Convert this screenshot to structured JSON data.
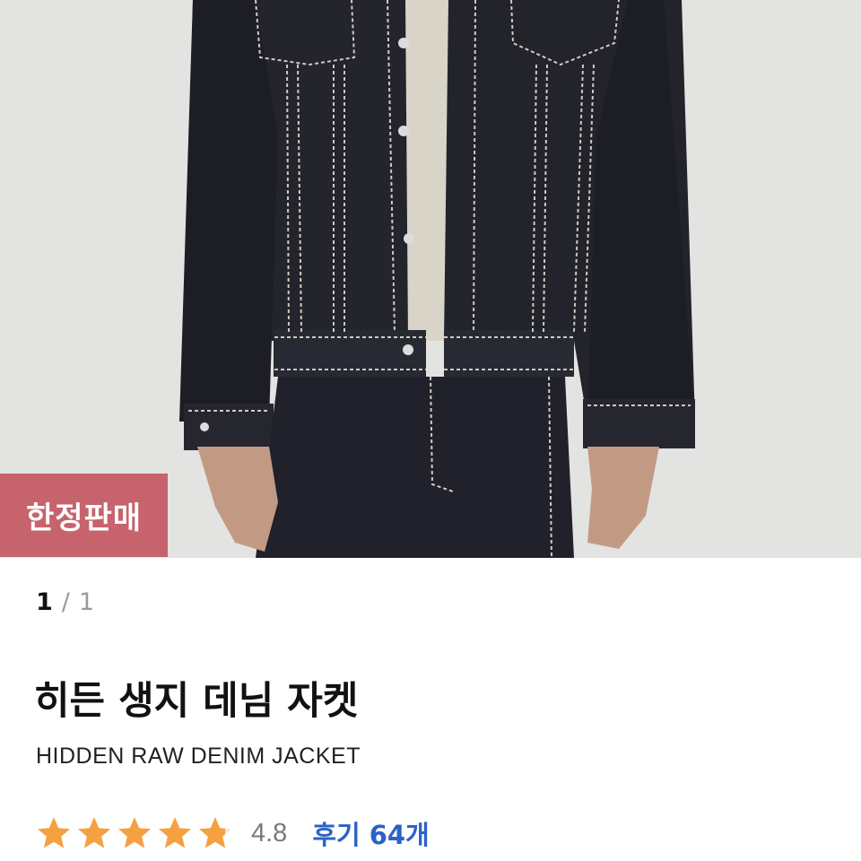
{
  "product_image": {
    "alt": "",
    "badge_label": "한정판매"
  },
  "pager": {
    "current": "1",
    "separator": "/",
    "total": "1"
  },
  "product": {
    "name": "히든 생지 데님 자켓",
    "name_en": "HIDDEN RAW DENIM JACKET"
  },
  "rating": {
    "score": "4.8",
    "stars": 4.8,
    "reviews_label": "후기",
    "reviews_count": "64개"
  },
  "colors": {
    "badge": "#c6636c",
    "star": "#f5a142",
    "reviews_link": "#2b62c7"
  }
}
